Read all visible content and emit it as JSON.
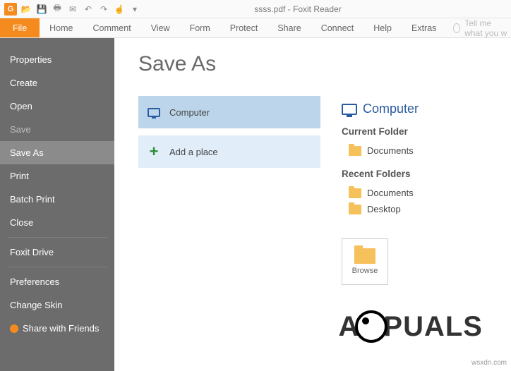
{
  "window": {
    "title": "ssss.pdf - Foxit Reader"
  },
  "ribbon": {
    "file": "File",
    "tabs": [
      "Home",
      "Comment",
      "View",
      "Form",
      "Protect",
      "Share",
      "Connect",
      "Help",
      "Extras"
    ],
    "tellme": "Tell me what you w"
  },
  "sidebar": {
    "items": [
      {
        "label": "Properties",
        "state": "normal"
      },
      {
        "label": "Create",
        "state": "normal"
      },
      {
        "label": "Open",
        "state": "normal"
      },
      {
        "label": "Save",
        "state": "disabled"
      },
      {
        "label": "Save As",
        "state": "selected"
      },
      {
        "label": "Print",
        "state": "normal"
      },
      {
        "label": "Batch Print",
        "state": "normal"
      },
      {
        "label": "Close",
        "state": "normal"
      },
      {
        "label": "Foxit Drive",
        "state": "normal",
        "sepBefore": true
      },
      {
        "label": "Preferences",
        "state": "normal",
        "sepBefore": true
      },
      {
        "label": "Change Skin",
        "state": "normal"
      },
      {
        "label": "Share with Friends",
        "state": "normal",
        "icon": "friend"
      }
    ]
  },
  "main": {
    "heading": "Save As",
    "places": [
      {
        "label": "Computer",
        "icon": "monitor",
        "selected": true
      },
      {
        "label": "Add a place",
        "icon": "plus",
        "selected": false
      }
    ],
    "right": {
      "title": "Computer",
      "currentFolderHeading": "Current Folder",
      "currentFolders": [
        "Documents"
      ],
      "recentFoldersHeading": "Recent Folders",
      "recentFolders": [
        "Documents",
        "Desktop"
      ],
      "browseLabel": "Browse"
    }
  },
  "watermark": {
    "pre": "A",
    "post": "PUALS"
  },
  "attribution": "wsxdn.com"
}
